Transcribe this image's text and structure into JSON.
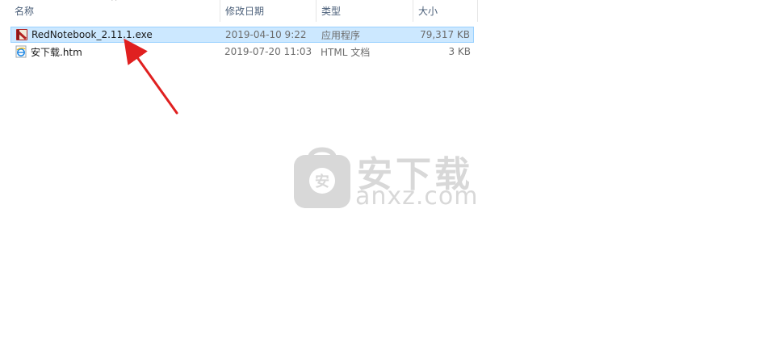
{
  "header": {
    "name": "名称",
    "date": "修改日期",
    "type": "类型",
    "size": "大小",
    "sort_indicator": "^"
  },
  "files": [
    {
      "name": "RedNotebook_2.11.1.exe",
      "date": "2019-04-10 9:22",
      "type": "应用程序",
      "size": "79,317 KB",
      "icon": "exe-icon",
      "selected": true
    },
    {
      "name": "安下载.htm",
      "date": "2019-07-20 11:03",
      "type": "HTML 文档",
      "size": "3 KB",
      "icon": "html-document-icon",
      "selected": false
    }
  ],
  "watermark": {
    "text": "安下载",
    "domain": "anxz.com",
    "badge_char": "安"
  },
  "colors": {
    "selection_bg": "#cce8ff",
    "selection_border": "#99d1ff",
    "arrow": "#e02020",
    "header_text": "#4c607a"
  }
}
